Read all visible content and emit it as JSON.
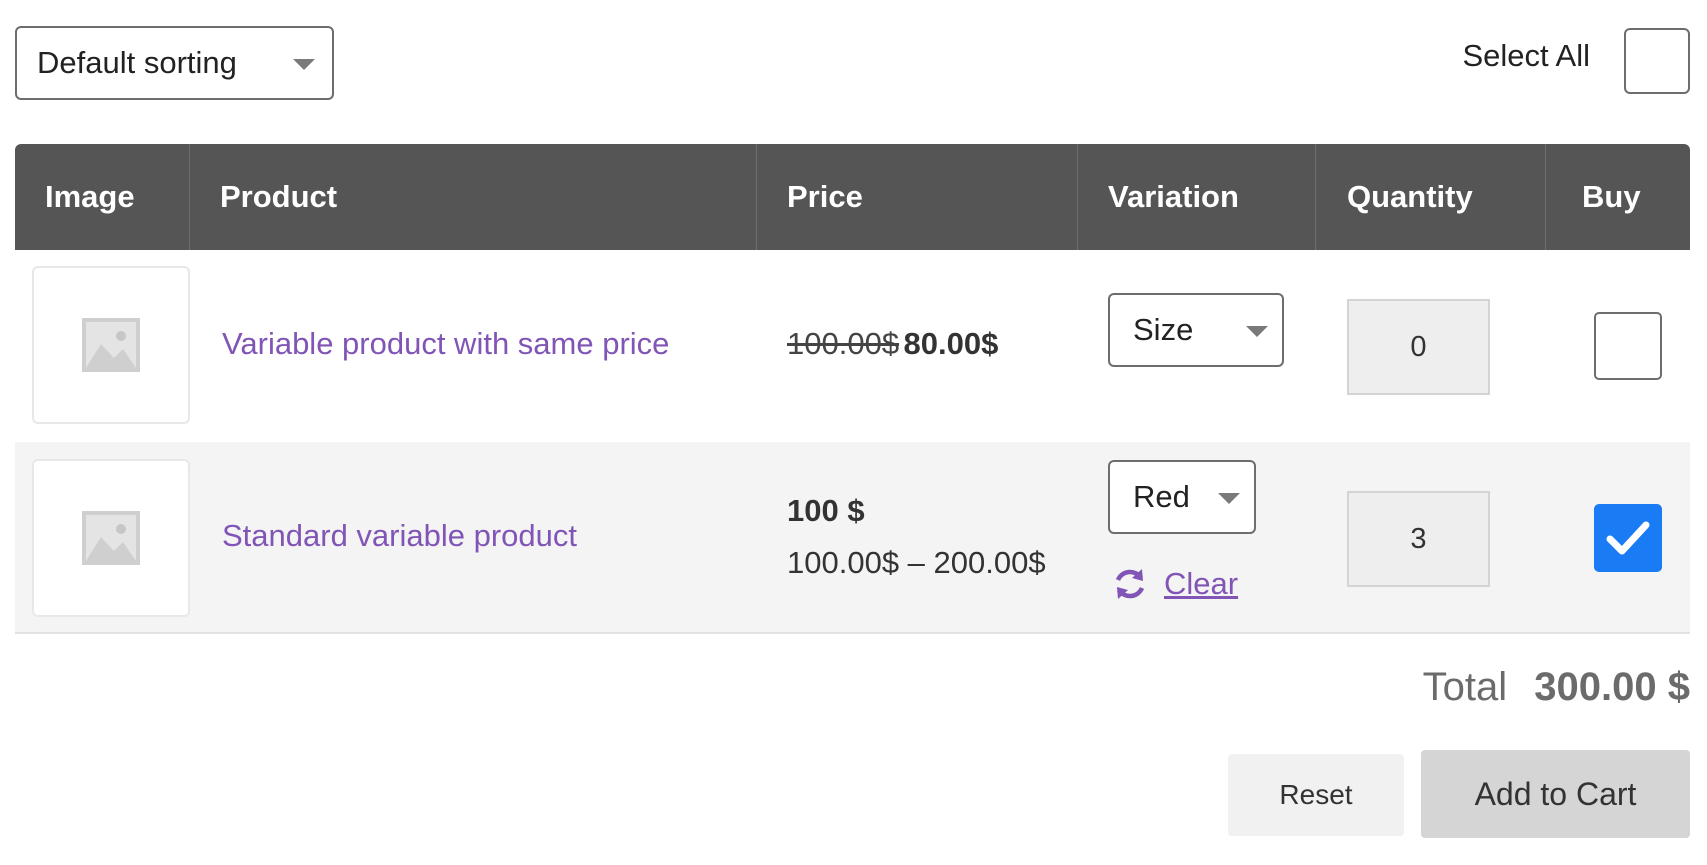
{
  "toolbar": {
    "sort_value": "Default sorting",
    "select_all_label": "Select All"
  },
  "table": {
    "headers": [
      "Image",
      "Product",
      "Price",
      "Variation",
      "Quantity",
      "Buy"
    ],
    "rows": [
      {
        "product": "Variable product with same price",
        "price_old": "100.00$",
        "price_new": "80.00$",
        "variation": "Size",
        "quantity": "0",
        "buy_checked": false
      },
      {
        "product": "Standard variable product",
        "price_main": "100 $",
        "price_range": "100.00$ – 200.00$",
        "variation": "Red",
        "clear_label": "Clear",
        "quantity": "3",
        "buy_checked": true
      }
    ]
  },
  "footer": {
    "total_label": "Total",
    "total_value": "300.00 $",
    "reset_label": "Reset",
    "add_to_cart_label": "Add to Cart"
  },
  "colors": {
    "header_bg": "#555555",
    "link": "#8155b6",
    "checkbox_checked": "#1a7cf5"
  }
}
